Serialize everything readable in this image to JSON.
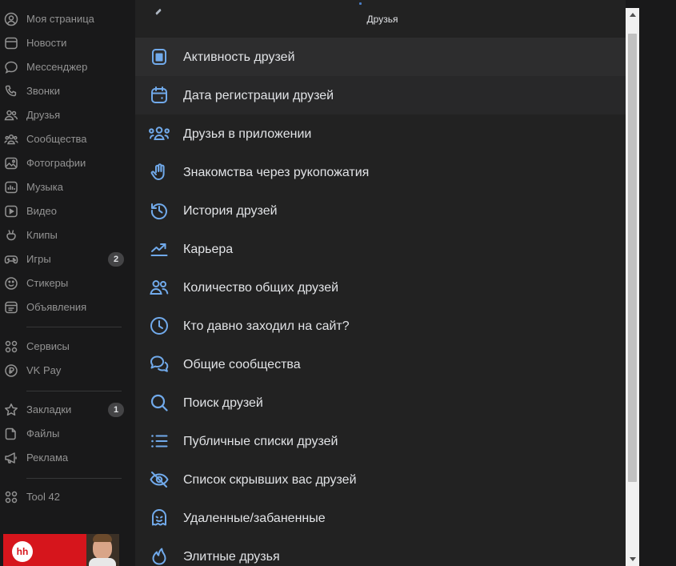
{
  "colors": {
    "accent": "#71aaeb",
    "sidebar_text": "#939393",
    "panel_bg": "#222222",
    "page_bg": "#19191a",
    "promo_red": "#d6151c"
  },
  "sidebar": {
    "items": [
      {
        "label": "Моя страница",
        "icon": "user-circle-icon"
      },
      {
        "label": "Новости",
        "icon": "newsfeed-icon"
      },
      {
        "label": "Мессенджер",
        "icon": "message-icon"
      },
      {
        "label": "Звонки",
        "icon": "phone-icon"
      },
      {
        "label": "Друзья",
        "icon": "friends-icon"
      },
      {
        "label": "Сообщества",
        "icon": "communities-icon"
      },
      {
        "label": "Фотографии",
        "icon": "photo-icon"
      },
      {
        "label": "Музыка",
        "icon": "music-icon"
      },
      {
        "label": "Видео",
        "icon": "video-icon"
      },
      {
        "label": "Клипы",
        "icon": "clips-icon"
      },
      {
        "label": "Игры",
        "icon": "gamepad-icon",
        "badge": "2"
      },
      {
        "label": "Стикеры",
        "icon": "smile-icon"
      },
      {
        "label": "Объявления",
        "icon": "ads-board-icon"
      },
      {
        "label": "Сервисы",
        "icon": "services-grid-icon"
      },
      {
        "label": "VK Pay",
        "icon": "ruble-icon"
      },
      {
        "label": "Закладки",
        "icon": "star-icon",
        "badge": "1"
      },
      {
        "label": "Файлы",
        "icon": "file-icon"
      },
      {
        "label": "Реклама",
        "icon": "megaphone-icon"
      },
      {
        "label": "Tool 42",
        "icon": "app-grid-icon"
      }
    ]
  },
  "promo": {
    "logo_text": "hh"
  },
  "panel": {
    "title": "Друзья",
    "items": [
      {
        "label": "Активность друзей",
        "icon": "activity-icon"
      },
      {
        "label": "Дата регистрации друзей",
        "icon": "calendar-icon"
      },
      {
        "label": "Друзья в приложении",
        "icon": "users-app-icon"
      },
      {
        "label": "Знакомства через рукопожатия",
        "icon": "hand-icon"
      },
      {
        "label": "История друзей",
        "icon": "history-icon"
      },
      {
        "label": "Карьера",
        "icon": "trending-icon"
      },
      {
        "label": "Количество общих друзей",
        "icon": "mutual-friends-icon"
      },
      {
        "label": "Кто давно заходил на сайт?",
        "icon": "clock-icon"
      },
      {
        "label": "Общие сообщества",
        "icon": "chats-icon"
      },
      {
        "label": "Поиск друзей",
        "icon": "search-icon"
      },
      {
        "label": "Публичные списки друзей",
        "icon": "list-icon"
      },
      {
        "label": "Список скрывших вас друзей",
        "icon": "hidden-eye-icon"
      },
      {
        "label": "Удаленные/забаненные",
        "icon": "ghost-icon"
      },
      {
        "label": "Элитные друзья",
        "icon": "flame-icon"
      }
    ]
  }
}
